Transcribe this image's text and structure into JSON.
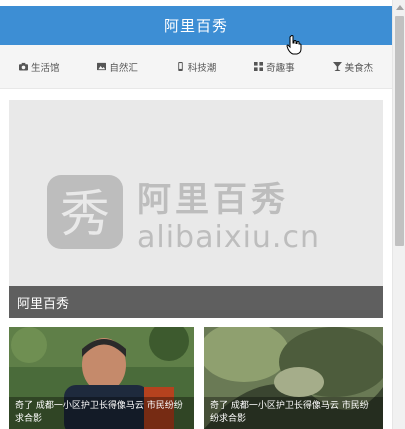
{
  "header": {
    "title": "阿里百秀"
  },
  "nav": {
    "items": [
      {
        "label": "生活馆",
        "icon": "camera-icon"
      },
      {
        "label": "自然汇",
        "icon": "picture-icon"
      },
      {
        "label": "科技潮",
        "icon": "mobile-icon"
      },
      {
        "label": "奇趣事",
        "icon": "grid-icon"
      },
      {
        "label": "美食杰",
        "icon": "cup-icon"
      }
    ]
  },
  "banner": {
    "logo_glyph": "秀",
    "logo_text": "阿里百秀",
    "logo_domain": "alibaixiu.cn",
    "caption": "阿里百秀"
  },
  "news": [
    {
      "caption": "奇了 成都一小区护卫长得像马云 市民纷纷求合影"
    },
    {
      "caption": "奇了 成都一小区护卫长得像马云 市民纷纷求合影"
    }
  ],
  "colors": {
    "header": "#3d8ed4",
    "nav_bg": "#f5f5f5",
    "caption_bg": "#5f5f5f"
  }
}
